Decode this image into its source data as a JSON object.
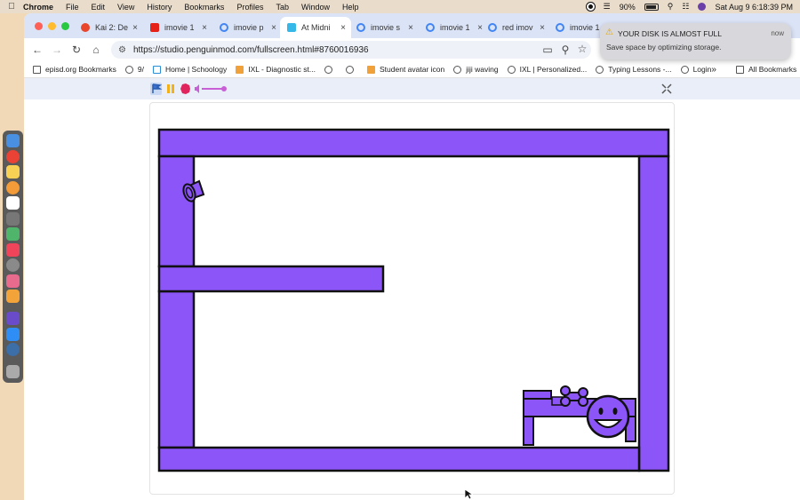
{
  "menubar": {
    "app": "Chrome",
    "items": [
      "File",
      "Edit",
      "View",
      "History",
      "Bookmarks",
      "Profiles",
      "Tab",
      "Window",
      "Help"
    ],
    "battery": "90%",
    "clock": "Sat Aug 9  6:18:39 PM"
  },
  "tabs": [
    {
      "label": "Kai 2: De",
      "icon": "fire-icon",
      "color": "#e8452c"
    },
    {
      "label": "imovie 1",
      "icon": "youtube-icon",
      "color": "#e62117"
    },
    {
      "label": "imovie p",
      "icon": "google-icon",
      "color": "#4285f4"
    },
    {
      "label": "At Midni",
      "icon": "penguinmod-icon",
      "color": "#35b8e8"
    },
    {
      "label": "imovie s",
      "icon": "google-icon",
      "color": "#4285f4"
    },
    {
      "label": "imovie 1",
      "icon": "google-icon",
      "color": "#4285f4"
    },
    {
      "label": "red imov",
      "icon": "google-icon",
      "color": "#4285f4"
    },
    {
      "label": "imovie 1",
      "icon": "google-icon",
      "color": "#4285f4"
    }
  ],
  "address": {
    "url": "https://studio.penguinmod.com/fullscreen.html#8760016936"
  },
  "bookmarks": [
    {
      "label": "episd.org Bookmarks",
      "icon": "folder-icon"
    },
    {
      "label": "9/",
      "icon": "globe-icon"
    },
    {
      "label": "Home | Schoology",
      "icon": "schoology-icon"
    },
    {
      "label": "IXL - Diagnostic st...",
      "icon": "ixl-icon"
    },
    {
      "label": "",
      "icon": "globe-icon"
    },
    {
      "label": "",
      "icon": "globe-icon"
    },
    {
      "label": "Student avatar icon",
      "icon": "ixl-icon"
    },
    {
      "label": "jiji waving",
      "icon": "globe-icon"
    },
    {
      "label": "IXL | Personalized...",
      "icon": "globe-icon"
    },
    {
      "label": "Typing Lessons -...",
      "icon": "globe-icon"
    },
    {
      "label": "Login",
      "icon": "globe-icon"
    }
  ],
  "all_bookmarks": "All Bookmarks",
  "notification": {
    "title": "YOUR DISK IS ALMOST FULL",
    "time": "now",
    "body": "Save space by optimizing storage."
  },
  "colors": {
    "wall": "#8c55f7",
    "outline": "#111111"
  }
}
